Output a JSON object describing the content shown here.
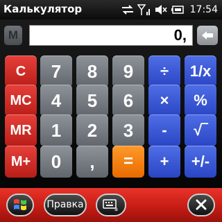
{
  "statusbar": {
    "title": "Калькулятор",
    "time": "17:54",
    "icons": [
      "sync-icon",
      "signal-icon",
      "volume-mute-icon",
      "battery-charging-icon"
    ]
  },
  "memory_indicator": "M",
  "display": {
    "value": "0,"
  },
  "keys": {
    "c": "C",
    "mc": "MC",
    "mr": "MR",
    "mplus": "M+",
    "n7": "7",
    "n8": "8",
    "n9": "9",
    "n4": "4",
    "n5": "5",
    "n6": "6",
    "n1": "1",
    "n2": "2",
    "n3": "3",
    "n0": "0",
    "comma": ",",
    "equals": "=",
    "divide": "÷",
    "multiply": "×",
    "minus": "-",
    "plus": "+",
    "reciprocal": "1/x",
    "percent": "%",
    "sqrt": "√‾",
    "plusminus": "+/-"
  },
  "softbar": {
    "menu_label": "Правка"
  },
  "colors": {
    "red_key": "#d0302a",
    "gray_key": "#777c82",
    "blue_key": "#3a56d6",
    "orange_key": "#f47f10",
    "softbar": "#c71c14"
  }
}
